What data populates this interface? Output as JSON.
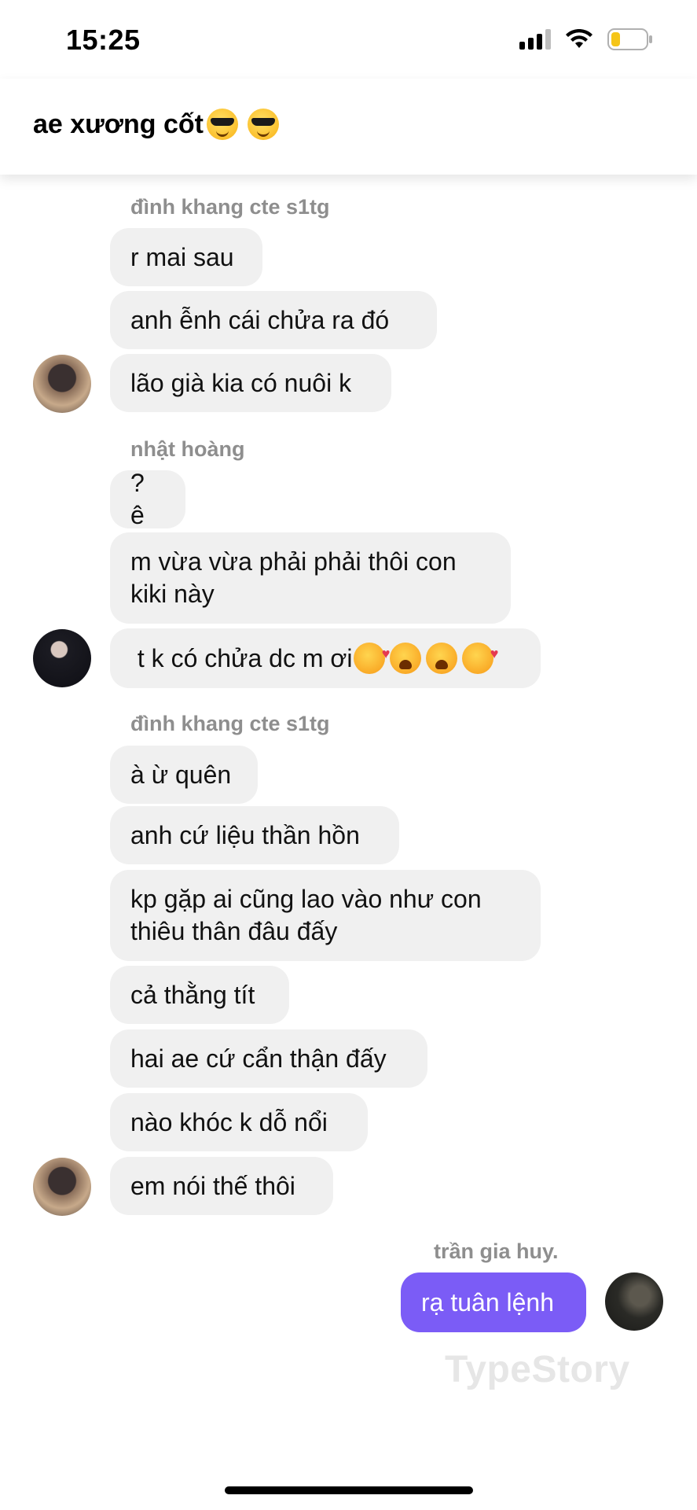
{
  "status_bar": {
    "time": "15:25",
    "icons": [
      "cellular-signal-icon",
      "wifi-icon",
      "battery-icon"
    ],
    "battery_level": 0.25,
    "battery_color": "#f5c518"
  },
  "header": {
    "title": "ae xương cốt",
    "title_emojis": [
      "smiling-face-with-sunglasses",
      "smiling-face-with-sunglasses"
    ]
  },
  "colors": {
    "incoming_bubble": "#f0f0f0",
    "outgoing_bubble": "#7b5cf6",
    "sender_name": "#8e8e8e"
  },
  "messages": {
    "group1": {
      "sender": "đình khang cte s1tg",
      "items": [
        "r mai sau",
        "anh ễnh cái chửa ra đó",
        "lão già kia có nuôi k"
      ]
    },
    "group2": {
      "sender": "nhật hoàng",
      "items": [
        "? ê",
        "m vừa vừa phải phải thôi con\nkiki này",
        " t k có chửa dc m ơi"
      ],
      "last_emojis": [
        "smiling-face-with-hearts",
        "weary-face",
        "weary-face",
        "smiling-face-with-hearts"
      ]
    },
    "group3": {
      "sender": "đình khang cte s1tg",
      "items": [
        "à ừ quên",
        "anh cứ liệu thần hồn",
        "kp gặp ai cũng lao vào như con\nthiêu thân đâu đấy",
        "cả thằng tít",
        "hai ae cứ cẩn thận đấy",
        "nào khóc k dỗ nổi",
        "em nói thế thôi"
      ]
    },
    "outgoing": {
      "sender": "trần gia huy.",
      "text": "rạ tuân lệnh"
    }
  },
  "watermark": "TypeStory"
}
